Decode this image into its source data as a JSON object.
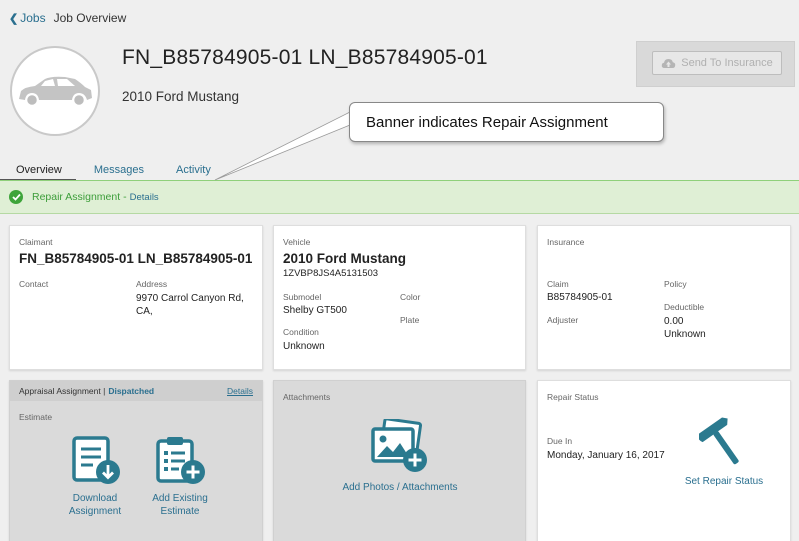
{
  "breadcrumb": {
    "back_label": "Jobs",
    "current": "Job Overview"
  },
  "header": {
    "title": "FN_B85784905-01 LN_B85784905-01",
    "subtitle": "2010 Ford Mustang",
    "send_button": "Send To Insurance"
  },
  "callout": {
    "text": "Banner indicates Repair Assignment"
  },
  "tabs": [
    {
      "label": "Overview",
      "active": true
    },
    {
      "label": "Messages",
      "active": false
    },
    {
      "label": "Activity",
      "active": false
    }
  ],
  "banner": {
    "text": "Repair Assignment",
    "separator": "-",
    "link": "Details"
  },
  "claimant": {
    "heading": "Claimant",
    "name": "FN_B85784905-01 LN_B85784905-01",
    "contact_label": "Contact",
    "address_label": "Address",
    "address_line1": "9970 Carrol Canyon Rd,",
    "address_line2": "CA,"
  },
  "vehicle": {
    "heading": "Vehicle",
    "name": "2010 Ford Mustang",
    "vin": "1ZVBP8JS4A5131503",
    "submodel_label": "Submodel",
    "submodel": "Shelby GT500",
    "color_label": "Color",
    "plate_label": "Plate",
    "condition_label": "Condition",
    "condition": "Unknown"
  },
  "insurance": {
    "heading": "Insurance",
    "claim_label": "Claim",
    "claim": "B85784905-01",
    "policy_label": "Policy",
    "deductible_label": "Deductible",
    "deductible": "0.00",
    "deductible_sub": "Unknown",
    "adjuster_label": "Adjuster"
  },
  "appraisal": {
    "heading": "Appraisal Assignment |",
    "status": "Dispatched",
    "details": "Details",
    "estimate_label": "Estimate",
    "download_line1": "Download",
    "download_line2": "Assignment",
    "add_line1": "Add Existing",
    "add_line2": "Estimate"
  },
  "attachments": {
    "heading": "Attachments",
    "add_label": "Add Photos / Attachments"
  },
  "repair_status": {
    "heading": "Repair Status",
    "due_label": "Due In",
    "due_date": "Monday, January 16, 2017",
    "set_label": "Set Repair Status"
  },
  "colors": {
    "accent": "#2a6f8f",
    "icon": "#2b7a8f",
    "success": "#3ea43a",
    "banner_bg": "#dfefd5"
  },
  "icons": [
    "chevron-left-icon",
    "car-icon",
    "cloud-upload-icon",
    "check-circle-icon",
    "download-document-icon",
    "clipboard-add-icon",
    "photos-add-icon",
    "hammer-icon"
  ]
}
